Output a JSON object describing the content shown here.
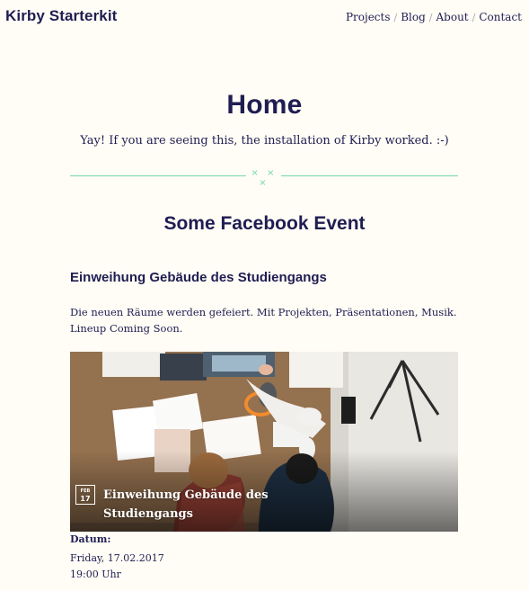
{
  "header": {
    "logo": "Kirby Starterkit",
    "nav": [
      {
        "label": "Projects"
      },
      {
        "label": "Blog"
      },
      {
        "label": "About"
      },
      {
        "label": "Contact"
      }
    ],
    "separator": "/"
  },
  "hero": {
    "title": "Home",
    "subtitle": "Yay! If you are seeing this, the installation of Kirby worked. :-)"
  },
  "divider": {
    "ornament": "× × ×"
  },
  "section": {
    "title": "Some Facebook Event"
  },
  "event": {
    "title": "Einweihung Gebäude des Studiengangs",
    "description": "Die neuen Räume werden gefeiert. Mit Projekten, Präsentationen, Musik. Lineup Coming Soon.",
    "image": {
      "caption": "Einweihung Gebäude des Studiengangs",
      "badge_month": "FEB",
      "badge_day": "17"
    },
    "date_label": "Datum:",
    "date_line1": "Friday, 17.02.2017",
    "date_line2": "19:00 Uhr"
  },
  "colors": {
    "background": "#fffdf5",
    "primary_text": "#1f1d52",
    "accent": "#78d7a7"
  }
}
